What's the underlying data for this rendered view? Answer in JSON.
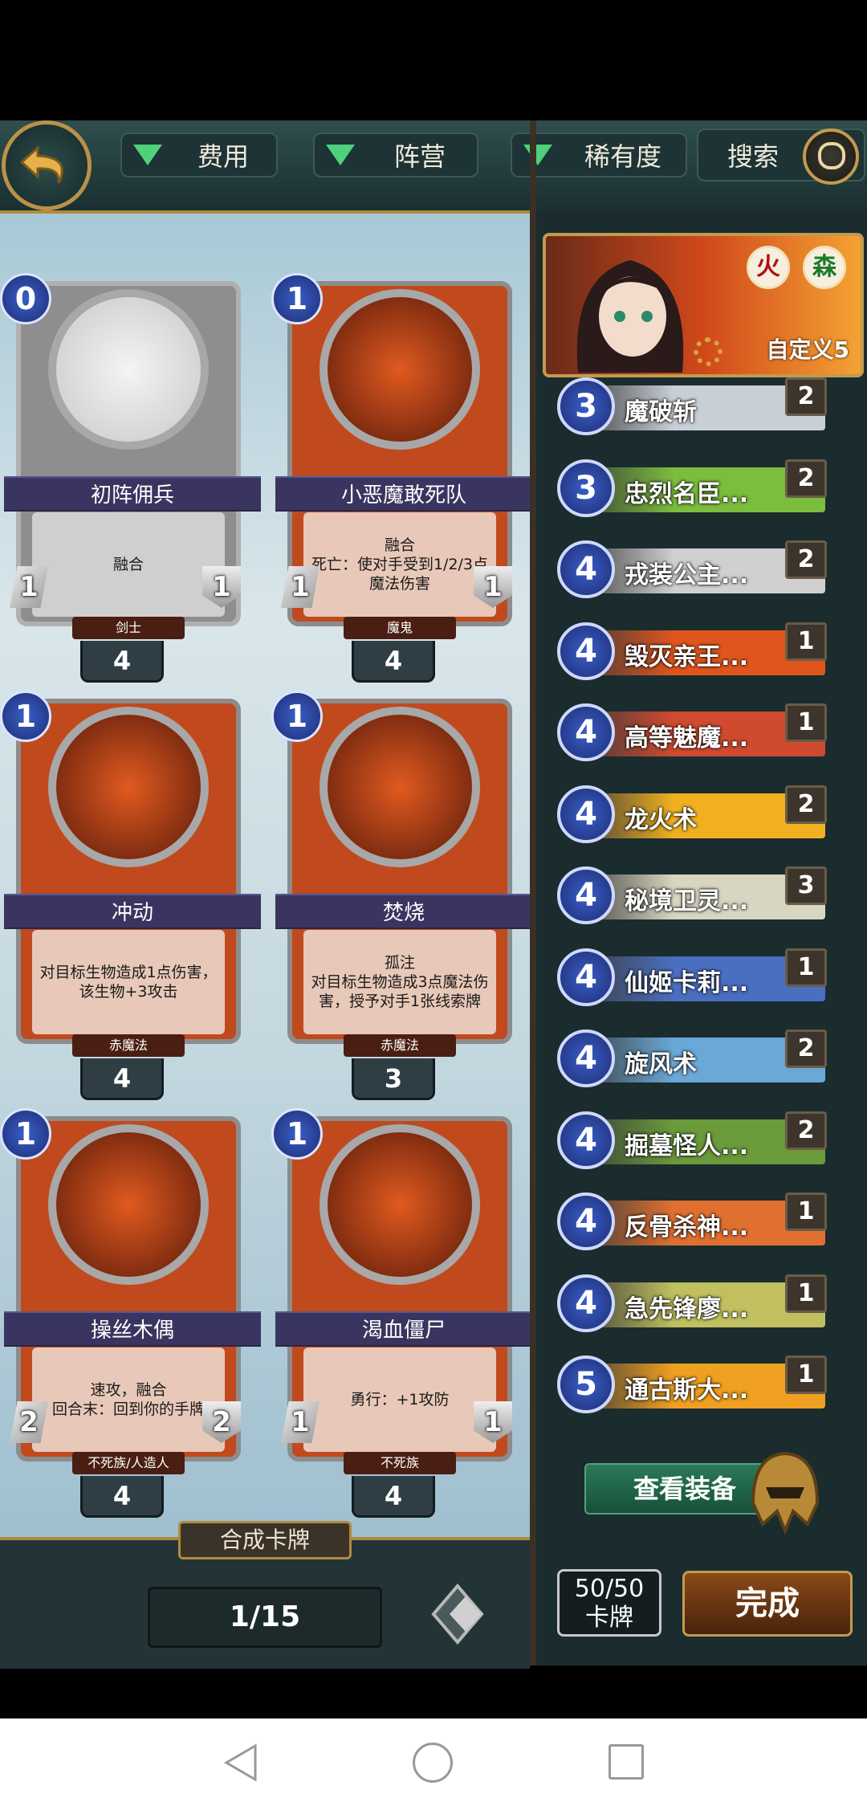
{
  "filters": [
    {
      "label": "费用"
    },
    {
      "label": "阵营"
    },
    {
      "label": "稀有度"
    }
  ],
  "search": {
    "label": "搜索"
  },
  "cards": [
    {
      "cost": "0",
      "name": "初阵佣兵",
      "text": "融合",
      "atk": "1",
      "hp": "1",
      "race": "剑士",
      "count": "4",
      "frame": "gray"
    },
    {
      "cost": "1",
      "name": "小恶魔敢死队",
      "text": "融合\n死亡：使对手受到1/2/3点魔法伤害",
      "atk": "1",
      "hp": "1",
      "race": "魔鬼",
      "count": "4",
      "frame": "red"
    },
    {
      "cost": "1",
      "name": "冲动",
      "text": "对目标生物造成1点伤害，该生物+3攻击",
      "atk": "",
      "hp": "",
      "race": "赤魔法",
      "count": "4",
      "frame": "red"
    },
    {
      "cost": "1",
      "name": "焚烧",
      "text": "孤注\n对目标生物造成3点魔法伤害，授予对手1张线索牌",
      "atk": "",
      "hp": "",
      "race": "赤魔法",
      "count": "3",
      "frame": "red"
    },
    {
      "cost": "1",
      "name": "操丝木偶",
      "text": "速攻，融合\n回合末：回到你的手牌",
      "atk": "2",
      "hp": "2",
      "race": "不死族/人造人",
      "count": "4",
      "frame": "red"
    },
    {
      "cost": "1",
      "name": "渴血僵尸",
      "text": "勇行：+1攻防",
      "atk": "1",
      "hp": "1",
      "race": "不死族",
      "count": "4",
      "frame": "red"
    }
  ],
  "craft_label": "合成卡牌",
  "page": "1/15",
  "hero": {
    "element1": "火",
    "element2": "森",
    "name": "自定义5"
  },
  "deck": [
    {
      "cost": "3",
      "name": "魔破斩",
      "qty": "2",
      "color": "#c9cfd6"
    },
    {
      "cost": "3",
      "name": "忠烈名臣...",
      "qty": "2",
      "color": "#7bbd3c"
    },
    {
      "cost": "4",
      "name": "戎装公主...",
      "qty": "2",
      "color": "#d0d0d0"
    },
    {
      "cost": "4",
      "name": "毁灭亲王...",
      "qty": "1",
      "color": "#e0551e"
    },
    {
      "cost": "4",
      "name": "高等魅魔...",
      "qty": "1",
      "color": "#d04a30"
    },
    {
      "cost": "4",
      "name": "龙火术",
      "qty": "2",
      "color": "#f0b020"
    },
    {
      "cost": "4",
      "name": "秘境卫灵...",
      "qty": "3",
      "color": "#d8d6c0"
    },
    {
      "cost": "4",
      "name": "仙姬卡莉...",
      "qty": "1",
      "color": "#4a6ec0"
    },
    {
      "cost": "4",
      "name": "旋风术",
      "qty": "2",
      "color": "#6aa8d8"
    },
    {
      "cost": "4",
      "name": "掘墓怪人...",
      "qty": "2",
      "color": "#6a9a3a"
    },
    {
      "cost": "4",
      "name": "反骨杀神...",
      "qty": "1",
      "color": "#e07030"
    },
    {
      "cost": "4",
      "name": "急先锋廖...",
      "qty": "1",
      "color": "#c0c060"
    },
    {
      "cost": "5",
      "name": "通古斯大...",
      "qty": "1",
      "color": "#f0a020"
    }
  ],
  "view_equipment": "查看装备",
  "card_count": {
    "value": "50/50",
    "label": "卡牌"
  },
  "done": "完成"
}
